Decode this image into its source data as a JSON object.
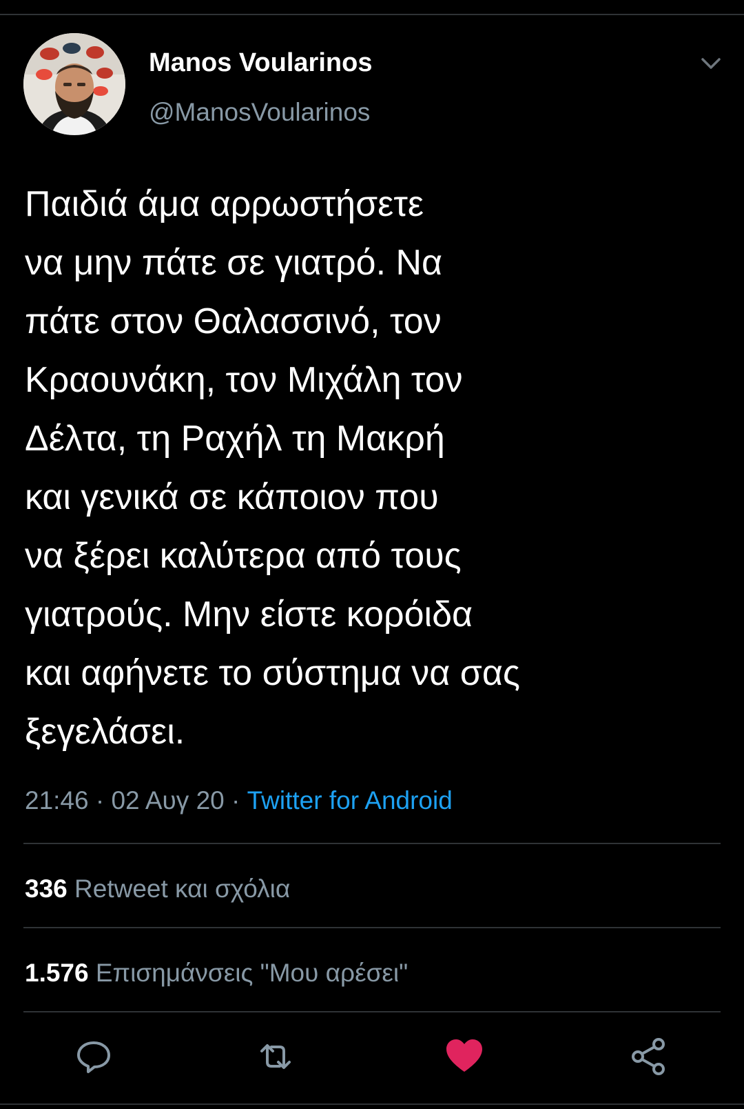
{
  "user": {
    "name": "Manos Voularinos",
    "handle": "@ManosVoularinos"
  },
  "tweet": {
    "lines": [
      "Παιδιά άμα αρρωστήσετε",
      "να μην πάτε σε γιατρό. Να",
      "πάτε στον Θαλασσινό, τον",
      "Κραουνάκη, τον Μιχάλη τον",
      "Δέλτα, τη Ραχήλ τη Μακρή",
      "και γενικά σε κάποιον που",
      "να ξέρει καλύτερα από τους",
      "γιατρούς. Μην είστε κορόιδα",
      "και αφήνετε το σύστημα να σας",
      "ξεγελάσει."
    ]
  },
  "meta": {
    "time": "21:46",
    "separator": " · ",
    "date": "02 Αυγ 20",
    "source": "Twitter for Android"
  },
  "stats": {
    "retweets_count": "336",
    "retweets_label": "Retweet και σχόλια",
    "likes_count": "1.576",
    "likes_label": "Επισημάνσεις \"Μου αρέσει\""
  },
  "icons": {
    "reply": "reply-icon",
    "retweet": "retweet-icon",
    "like": "heart-icon",
    "share": "share-icon",
    "menu": "chevron-down-icon"
  },
  "colors": {
    "background": "#000000",
    "secondary_text": "#8899a6",
    "link": "#1da1f2",
    "like": "#e0245e",
    "divider": "#2f3336"
  }
}
